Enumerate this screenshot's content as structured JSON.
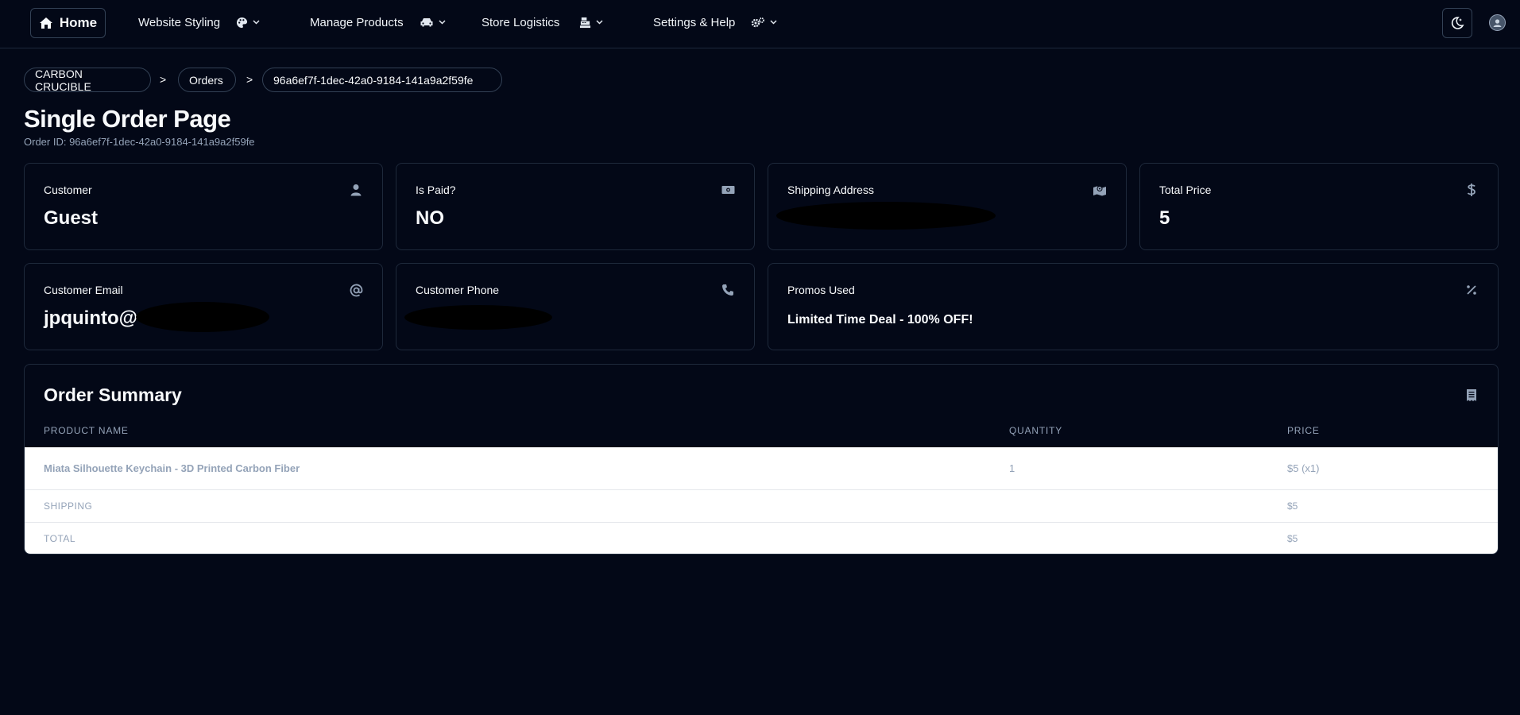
{
  "nav": {
    "home_label": "Home",
    "items": [
      {
        "label": "Website Styling",
        "icon": "palette-icon"
      },
      {
        "label": "Manage Products",
        "icon": "car-icon"
      },
      {
        "label": "Store Logistics",
        "icon": "cash-register-icon"
      },
      {
        "label": "Settings & Help",
        "icon": "gears-icon"
      }
    ]
  },
  "breadcrumb": {
    "items": [
      "CARBON CRUCIBLE",
      "Orders",
      "96a6ef7f-1dec-42a0-9184-141a9a2f59fe"
    ],
    "separator": ">"
  },
  "page": {
    "title": "Single Order Page",
    "order_id_text": "Order ID: 96a6ef7f-1dec-42a0-9184-141a9a2f59fe"
  },
  "cards": {
    "customer": {
      "label": "Customer",
      "value": "Guest"
    },
    "is_paid": {
      "label": "Is Paid?",
      "value": "NO"
    },
    "shipping_address": {
      "label": "Shipping Address"
    },
    "total_price": {
      "label": "Total Price",
      "value": "5"
    },
    "customer_email": {
      "label": "Customer Email",
      "value": "jpquinto@"
    },
    "customer_phone": {
      "label": "Customer Phone"
    },
    "promos_used": {
      "label": "Promos Used",
      "value": "Limited Time Deal - 100% OFF!"
    }
  },
  "summary": {
    "title": "Order Summary",
    "columns": [
      "PRODUCT NAME",
      "QUANTITY",
      "PRICE"
    ],
    "rows": [
      {
        "name": "Miata Silhouette Keychain - 3D Printed Carbon Fiber",
        "quantity": "1",
        "price": "$5 (x1)"
      }
    ],
    "shipping_label": "SHIPPING",
    "shipping_value": "$5",
    "total_label": "TOTAL",
    "total_value": "$5"
  },
  "colors": {
    "background": "#030817",
    "border": "#1e293b",
    "muted": "#94a3b8"
  }
}
